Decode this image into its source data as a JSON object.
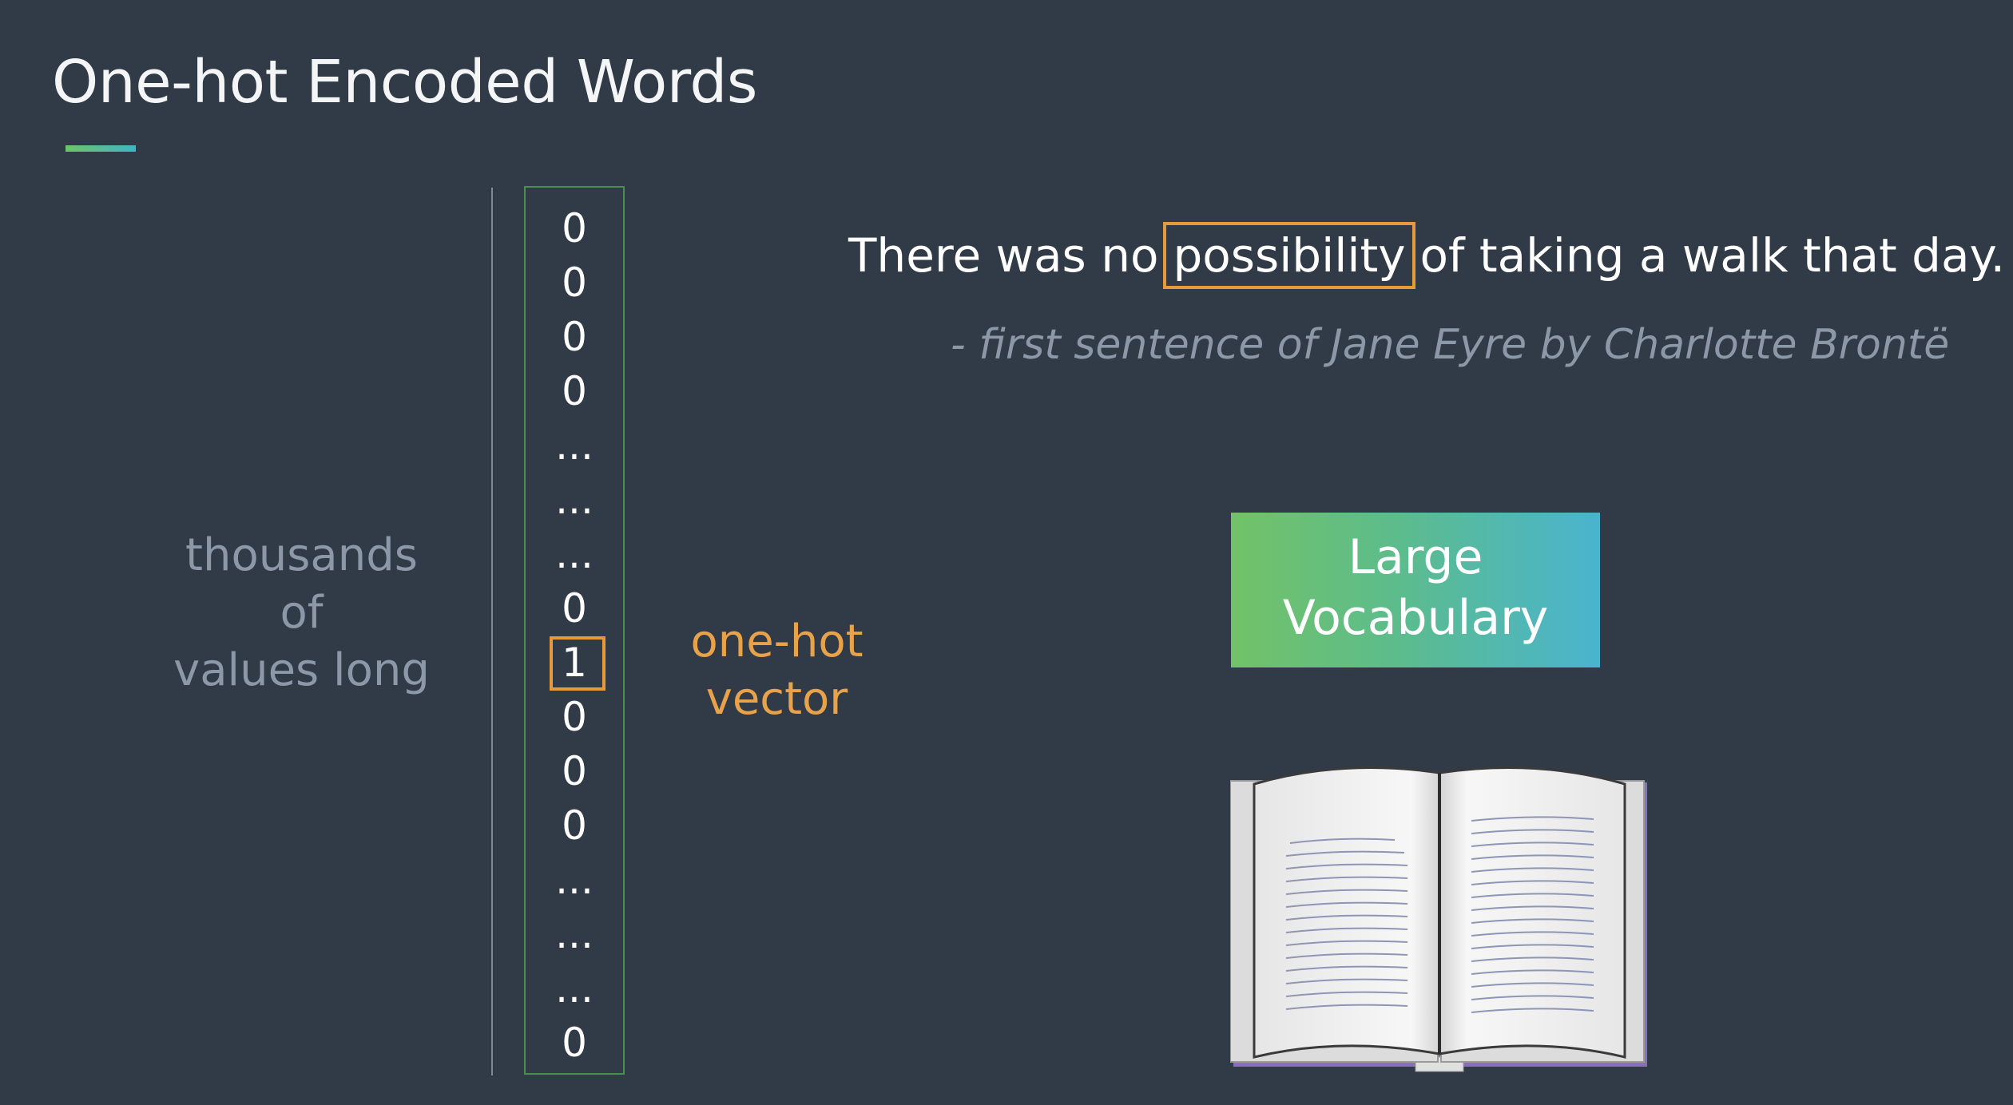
{
  "title": "One-hot Encoded Words",
  "colors": {
    "background": "#313b47",
    "accent_orange": "#e69a3a",
    "vector_border": "#4a8f4c",
    "muted_text": "#8c98a8",
    "gradient_start": "#72c267",
    "gradient_end": "#4ab4cf"
  },
  "vector": {
    "cells": [
      "0",
      "0",
      "0",
      "0",
      "...",
      "...",
      "...",
      "0",
      "1",
      "0",
      "0",
      "0",
      "...",
      "...",
      "...",
      "0"
    ],
    "hot_index": 8
  },
  "left_label": {
    "line1": "thousands",
    "line2": "of",
    "line3": "values long"
  },
  "onehot_label": {
    "line1": "one-hot",
    "line2": "vector"
  },
  "sentence": {
    "before": "There was no",
    "highlight": "possibility",
    "after": "of taking a walk that day."
  },
  "quote_source": "- first sentence of Jane Eyre by Charlotte Brontë",
  "vocab_box": {
    "line1": "Large",
    "line2": "Vocabulary"
  },
  "book_icon": "open-book-icon"
}
